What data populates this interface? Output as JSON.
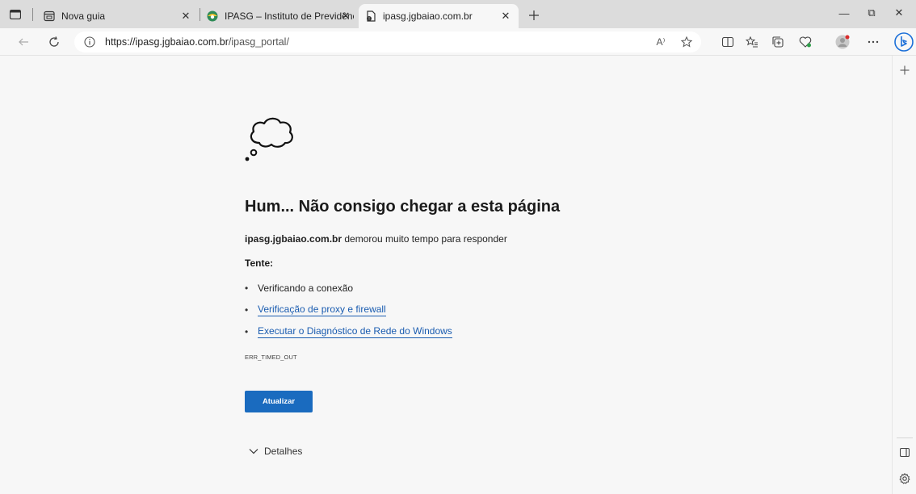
{
  "tabs": [
    {
      "title": "Nova guia",
      "close": "✕",
      "icon": "new-tab-page-icon"
    },
    {
      "title": "IPASG – Instituto de Previdência",
      "close": "✕",
      "icon": "site-favicon"
    },
    {
      "title": "ipasg.jgbaiao.com.br",
      "close": "✕",
      "icon": "page-error-icon"
    }
  ],
  "toolbar": {
    "url_host": "https://ipasg.jgbaiao.com.br",
    "url_path": "/ipasg_portal/",
    "read_aloud": "A⁾"
  },
  "window": {
    "minimize": "—",
    "restore": "⧉",
    "close": "✕"
  },
  "error": {
    "title": "Hum... Não consigo chegar a esta página",
    "host": "ipasg.jgbaiao.com.br",
    "desc_rest": " demorou muito tempo para responder",
    "try_label": "Tente:",
    "suggestions": [
      {
        "text": "Verificando a conexão",
        "link": false
      },
      {
        "text": "Verificação de proxy e firewall",
        "link": true
      },
      {
        "text": "Executar o Diagnóstico de Rede do Windows",
        "link": true
      }
    ],
    "code": "ERR_TIMED_OUT",
    "refresh_label": "Atualizar",
    "details_label": "Detalhes"
  },
  "colors": {
    "accent": "#1a6bbf",
    "link": "#1a5cb0",
    "page_bg": "#f7f7f7",
    "tabstrip_bg": "#dcdcdc"
  }
}
